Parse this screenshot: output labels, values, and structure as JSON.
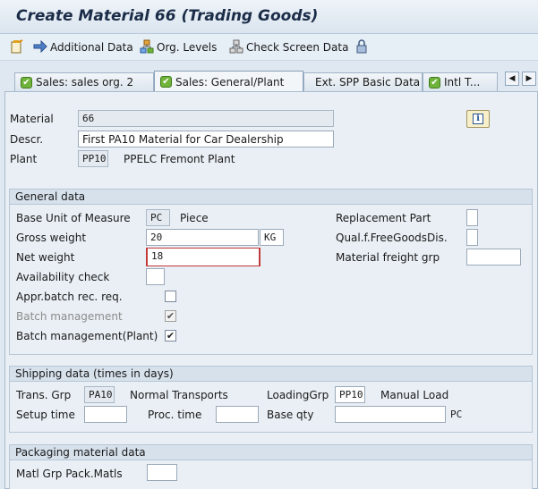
{
  "window": {
    "title": "Create Material 66 (Trading Goods)"
  },
  "toolbar": {
    "additional_data": "Additional Data",
    "org_levels": "Org. Levels",
    "check_screen_data": "Check Screen Data"
  },
  "tabs": [
    {
      "label": "Sales: sales org. 2",
      "checked": true
    },
    {
      "label": "Sales: General/Plant",
      "checked": true,
      "active": true
    },
    {
      "label": "Ext. SPP Basic Data",
      "checked": false
    },
    {
      "label": "Intl T...",
      "checked": true
    }
  ],
  "header": {
    "material_label": "Material",
    "material_value": "66",
    "descr_label": "Descr.",
    "descr_value": "First PA10 Material for Car Dealership",
    "plant_label": "Plant",
    "plant_value": "PP10",
    "plant_text": "PPELC Fremont Plant"
  },
  "general": {
    "title": "General data",
    "base_uom_label": "Base Unit of Measure",
    "base_uom_value": "PC",
    "base_uom_text": "Piece",
    "gross_weight_label": "Gross weight",
    "gross_weight_value": "20",
    "gross_weight_unit": "KG",
    "net_weight_label": "Net weight",
    "net_weight_value": "18",
    "availability_label": "Availability check",
    "availability_value": "",
    "appr_batch_label": "Appr.batch rec. req.",
    "appr_batch_checked": false,
    "batch_mgmt_label": "Batch management",
    "batch_mgmt_checked": true,
    "batch_mgmt_plant_label": "Batch management(Plant)",
    "batch_mgmt_plant_checked": true,
    "replacement_label": "Replacement Part",
    "replacement_value": "",
    "qual_free_label": "Qual.f.FreeGoodsDis.",
    "qual_free_value": "",
    "freight_grp_label": "Material freight grp",
    "freight_grp_value": ""
  },
  "shipping": {
    "title": "Shipping data (times in days)",
    "trans_grp_label": "Trans. Grp",
    "trans_grp_value": "PA10",
    "trans_grp_text": "Normal Transports",
    "loading_grp_label": "LoadingGrp",
    "loading_grp_value": "PP10",
    "loading_grp_text": "Manual Load",
    "setup_time_label": "Setup time",
    "setup_time_value": "",
    "proc_time_label": "Proc. time",
    "proc_time_value": "",
    "base_qty_label": "Base qty",
    "base_qty_value": "",
    "base_qty_unit": "PC"
  },
  "packaging": {
    "title": "Packaging material data",
    "matl_grp_label": "Matl Grp Pack.Matls",
    "matl_grp_value": ""
  },
  "checkbox_glyph": "✔",
  "colors": {
    "accent": "#1b2c48",
    "required": "#c23a3a"
  }
}
